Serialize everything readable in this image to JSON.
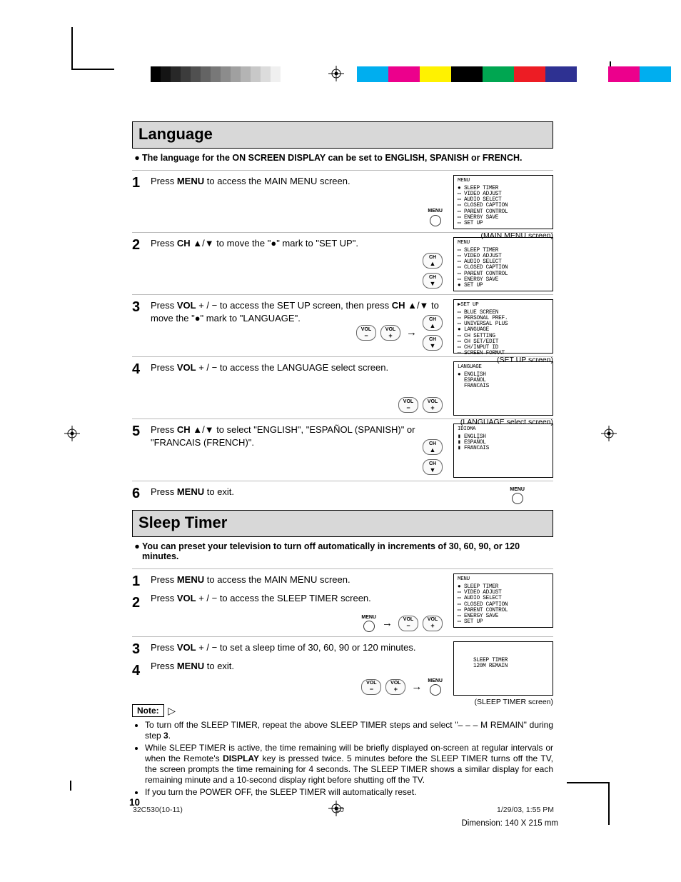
{
  "registration_marks": true,
  "color_bar_grays": [
    "#000",
    "#141414",
    "#282828",
    "#3c3c3c",
    "#505050",
    "#646464",
    "#787878",
    "#8c8c8c",
    "#a0a0a0",
    "#b4b4b4",
    "#c8c8c8",
    "#dcdcdc",
    "#f0f0f0",
    "#fff"
  ],
  "color_bar_colors": [
    "#00aeef",
    "#ec008c",
    "#fff200",
    "#000",
    "#00a651",
    "#ed1c24",
    "#2e3192",
    "#fff",
    "#ec008c",
    "#00aeef"
  ],
  "sections": {
    "language": {
      "title": "Language",
      "intro_bold": "The language for the ON SCREEN DISPLAY can be set to ENGLISH, SPANISH or FRENCH.",
      "steps": [
        {
          "num": "1",
          "html_parts": [
            "Press ",
            "MENU",
            " to access the MAIN MENU screen."
          ],
          "controls": [
            {
              "type": "menu"
            }
          ],
          "osd": {
            "title": "MENU",
            "lines": [
              "SLEEP TIMER",
              "VIDEO ADJUST",
              "AUDIO SELECT",
              "CLOSED CAPTION",
              "PARENT CONTROL",
              "ENERGY SAVE",
              "SET UP"
            ],
            "marker_index": 0
          },
          "caption": "(MAIN MENU screen)"
        },
        {
          "num": "2",
          "html_parts": [
            "Press ",
            "CH",
            " ▲/▼ to move the \"●\" mark to \"SET UP\"."
          ],
          "controls": [
            {
              "type": "ch-col"
            }
          ],
          "osd": {
            "title": "MENU",
            "lines": [
              "SLEEP TIMER",
              "VIDEO ADJUST",
              "AUDIO SELECT",
              "CLOSED CAPTION",
              "PARENT CONTROL",
              "ENERGY SAVE",
              "SET UP"
            ],
            "marker_index": 6
          }
        },
        {
          "num": "3",
          "html_parts": [
            "Press ",
            "VOL",
            " + / − to access the SET UP screen, then press ",
            "CH",
            " ▲/▼ to move the \"●\" mark to \"LANGUAGE\"."
          ],
          "controls": [
            {
              "type": "vol-pair"
            },
            {
              "type": "arrow"
            },
            {
              "type": "ch-col"
            }
          ],
          "osd": {
            "title": "▶SET UP",
            "lines": [
              "BLUE SCREEN",
              "PERSONAL PREF.",
              "UNIVERSAL PLUS",
              "LANGUAGE",
              "CH SETTING",
              "CH SET/EDIT",
              "CH/INPUT ID",
              "SCREEN FORMAT"
            ],
            "marker_index": 3
          },
          "caption": "(SET UP screen)"
        },
        {
          "num": "4",
          "html_parts": [
            "Press ",
            "VOL",
            " + / − to access the LANGUAGE select screen."
          ],
          "controls": [
            {
              "type": "vol-pair"
            }
          ],
          "osd": {
            "title": "LANGUAGE",
            "lines": [
              "ENGLISH",
              "ESPAÑOL",
              "FRANCAIS"
            ],
            "marker_index": 0,
            "plain": true
          },
          "caption": "(LANGUAGE select screen)"
        },
        {
          "num": "5",
          "html_parts": [
            "Press ",
            "CH",
            " ▲/▼ to select \"ENGLISH\", \"ESPAÑOL (SPANISH)\" or \"FRANCAIS (FRENCH)\"."
          ],
          "controls": [
            {
              "type": "ch-col"
            }
          ],
          "osd": {
            "title": "IDIOMA",
            "lines": [
              "ENGLISH",
              "ESPAÑOL",
              "FRANCAIS"
            ],
            "marker_index": 1,
            "bars": true
          }
        },
        {
          "num": "6",
          "short": true,
          "html_parts": [
            "Press ",
            "MENU",
            " to exit."
          ],
          "controls": [
            {
              "type": "menu"
            }
          ]
        }
      ]
    },
    "sleep_timer": {
      "title": "Sleep Timer",
      "intro_bold": "You can preset your television to turn off automatically in increments of 30, 60, 90, or 120 minutes.",
      "steps_a": {
        "nums": [
          "1",
          "2"
        ],
        "html1": [
          "Press ",
          "MENU",
          " to access the MAIN MENU screen."
        ],
        "html2": [
          "Press ",
          "VOL",
          " + / − to access the SLEEP TIMER screen."
        ],
        "controls": [
          {
            "type": "menu"
          },
          {
            "type": "arrow"
          },
          {
            "type": "vol-pair"
          }
        ],
        "osd": {
          "title": "MENU",
          "lines": [
            "SLEEP TIMER",
            "VIDEO ADJUST",
            "AUDIO SELECT",
            "CLOSED CAPTION",
            "PARENT CONTROL",
            "ENERGY SAVE",
            "SET UP"
          ],
          "marker_index": 0
        }
      },
      "steps_b": {
        "nums": [
          "3",
          "4"
        ],
        "html3": [
          "Press ",
          "VOL",
          " + / − to set a sleep time of 30, 60, 90 or 120 minutes."
        ],
        "html4": [
          "Press ",
          "MENU",
          " to exit."
        ],
        "controls": [
          {
            "type": "vol-pair"
          },
          {
            "type": "arrow"
          },
          {
            "type": "menu"
          }
        ],
        "osd": {
          "title": "",
          "lines_centered": [
            "SLEEP TIMER",
            "  120M REMAIN"
          ]
        },
        "caption": "(SLEEP TIMER screen)"
      },
      "note_label": "Note:",
      "notes": [
        [
          "To turn off the SLEEP TIMER, repeat the above SLEEP TIMER steps and select \"– – – M REMAIN\" during step ",
          "3",
          "."
        ],
        [
          "While SLEEP TIMER is active, the time remaining will be briefly displayed on-screen at regular intervals or when the Remote's ",
          "DISPLAY",
          " key is pressed twice. 5 minutes before the SLEEP TIMER turns off the TV, the screen prompts the time remaining for 4 seconds. The SLEEP TIMER shows a similar display for each remaining minute and a 10-second display right before shutting off the TV."
        ],
        [
          "If you turn the POWER OFF, the SLEEP TIMER will automatically reset."
        ]
      ]
    }
  },
  "page_number": "10",
  "footer": {
    "doc_id": "32C530(10-11)",
    "page": "10",
    "timestamp": "1/29/03, 1:55 PM",
    "dimension": "Dimension: 140  X 215 mm"
  },
  "labels": {
    "vol": "VOL",
    "ch": "CH",
    "menu": "MENU",
    "plus": "+",
    "minus": "−",
    "up": "▲",
    "down": "▼"
  }
}
